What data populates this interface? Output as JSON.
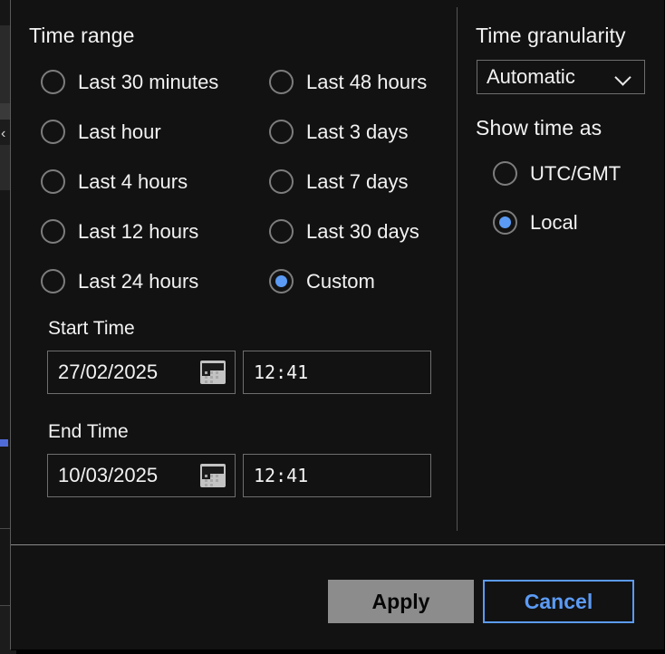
{
  "dialog": {
    "time_range": {
      "title": "Time range",
      "options_col1": [
        {
          "label": "Last 30 minutes",
          "selected": false
        },
        {
          "label": "Last hour",
          "selected": false
        },
        {
          "label": "Last 4 hours",
          "selected": false
        },
        {
          "label": "Last 12 hours",
          "selected": false
        },
        {
          "label": "Last 24 hours",
          "selected": false
        }
      ],
      "options_col2": [
        {
          "label": "Last 48 hours",
          "selected": false
        },
        {
          "label": "Last 3 days",
          "selected": false
        },
        {
          "label": "Last 7 days",
          "selected": false
        },
        {
          "label": "Last 30 days",
          "selected": false
        },
        {
          "label": "Custom",
          "selected": true
        }
      ]
    },
    "start_time": {
      "label": "Start Time",
      "date_value": "27/02/2025",
      "time_value": "12:41",
      "date_icon": "calendar-icon"
    },
    "end_time": {
      "label": "End Time",
      "date_value": "10/03/2025",
      "time_value": "12:41",
      "date_icon": "calendar-icon"
    },
    "granularity": {
      "title": "Time granularity",
      "selected": "Automatic",
      "chevron_icon": "chevron-down-icon"
    },
    "show_time_as": {
      "title": "Show time as",
      "options": [
        {
          "label": "UTC/GMT",
          "selected": false
        },
        {
          "label": "Local",
          "selected": true
        }
      ]
    },
    "footer": {
      "apply_label": "Apply",
      "cancel_label": "Cancel"
    },
    "colors": {
      "background": "#121212",
      "accent_blue": "#5b9bf5",
      "apply_button": "#8c8c8c",
      "text": "#f2f2f2",
      "border": "#6e6e6e"
    }
  }
}
